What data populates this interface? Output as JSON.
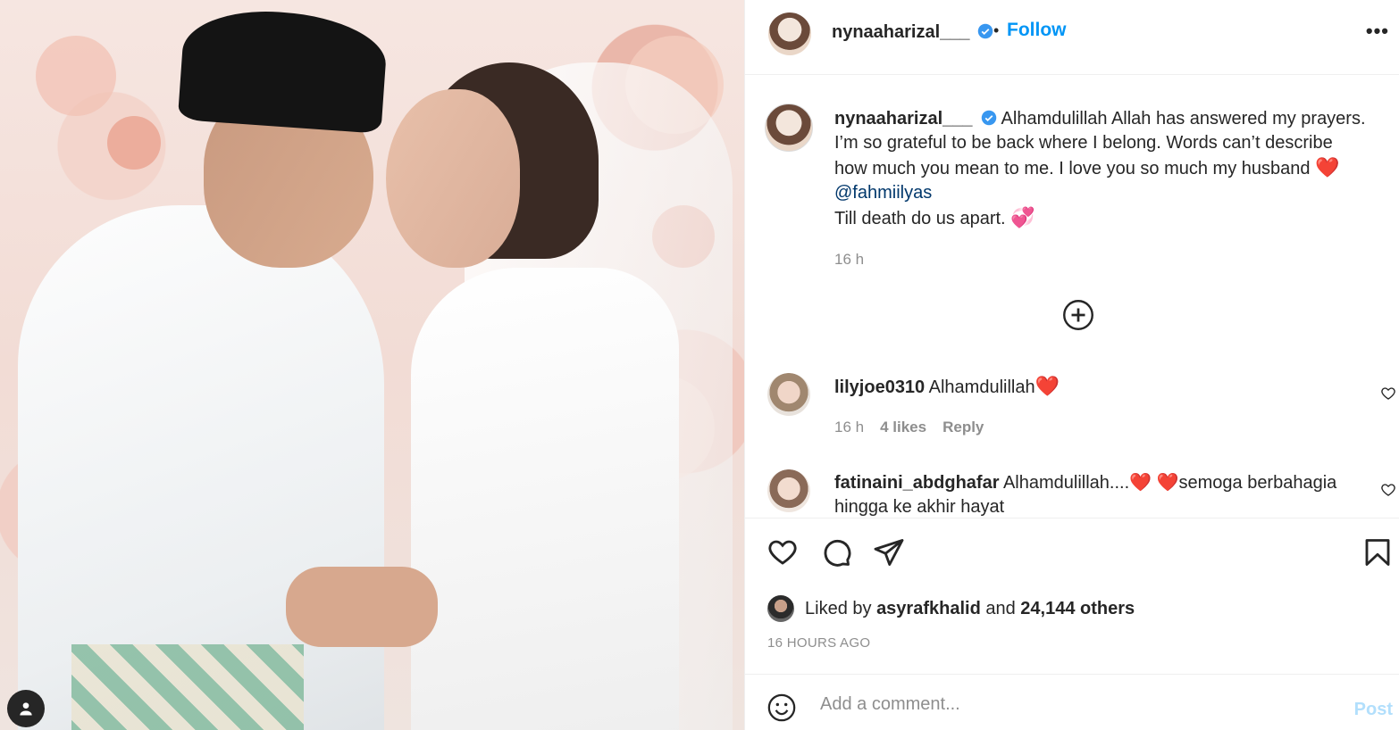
{
  "header": {
    "username": "nynaaharizal___",
    "separator": "•",
    "follow_label": "Follow",
    "more_label": "•••"
  },
  "caption": {
    "username": "nynaaharizal___",
    "text_line1": "Alhamdulillah Allah has answered my prayers.",
    "text_line2": "I’m so grateful to be back where I belong. Words can’t describe",
    "text_line3": "how much you mean to me. I love you so much my husband",
    "heart1": "❤️",
    "mention": "@fahmiilyas",
    "text_line5": "Till death do us apart.",
    "heart2": "💞",
    "time": "16 h"
  },
  "comments": [
    {
      "username": "lilyjoe0310",
      "text": "Alhamdulillah",
      "emoji": "❤️",
      "time": "16 h",
      "likes": "4 likes",
      "reply_label": "Reply"
    },
    {
      "username": "fatinaini_abdghafar",
      "text": "Alhamdulillah....❤️ ❤️semoga berbahagia",
      "text_line2": "hingga ke akhir hayat"
    }
  ],
  "likes": {
    "prefix": "Liked by",
    "liker": "asyrafkhalid",
    "middle": "and",
    "others": "24,144 others"
  },
  "timestamp": "16 HOURS AGO",
  "add_comment": {
    "placeholder": "Add a comment...",
    "post_label": "Post"
  },
  "colors": {
    "accent": "#0095f6",
    "verified": "#3897f0",
    "mention": "#00376b",
    "muted": "#8e8e8e",
    "post_disabled": "#b2dffc"
  }
}
